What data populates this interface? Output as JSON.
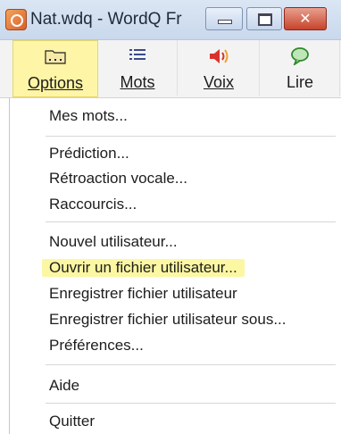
{
  "window": {
    "title": "Nat.wdq - WordQ Fr"
  },
  "toolbar": {
    "options": {
      "label": "Options",
      "icon": "folder-icon"
    },
    "mots": {
      "label": "Mots",
      "icon": "list-icon"
    },
    "voix": {
      "label": "Voix",
      "icon": "speaker-icon"
    },
    "lire": {
      "label": "Lire",
      "icon": "speech-bubble-icon"
    }
  },
  "menu": {
    "items": [
      "Mes mots...",
      "Prédiction...",
      "Rétroaction vocale...",
      "Raccourcis...",
      "Nouvel utilisateur...",
      "Ouvrir un fichier utilisateur...",
      "Enregistrer fichier utilisateur",
      "Enregistrer fichier utilisateur sous...",
      "Préférences...",
      "Aide",
      "Quitter"
    ],
    "highlighted": "Ouvrir un fichier utilisateur..."
  },
  "colors": {
    "active_tab": "#fff5a6",
    "highlight": "#fbf7a2",
    "close_button": "#c7432b",
    "titlebar": "#c9d8ec"
  }
}
